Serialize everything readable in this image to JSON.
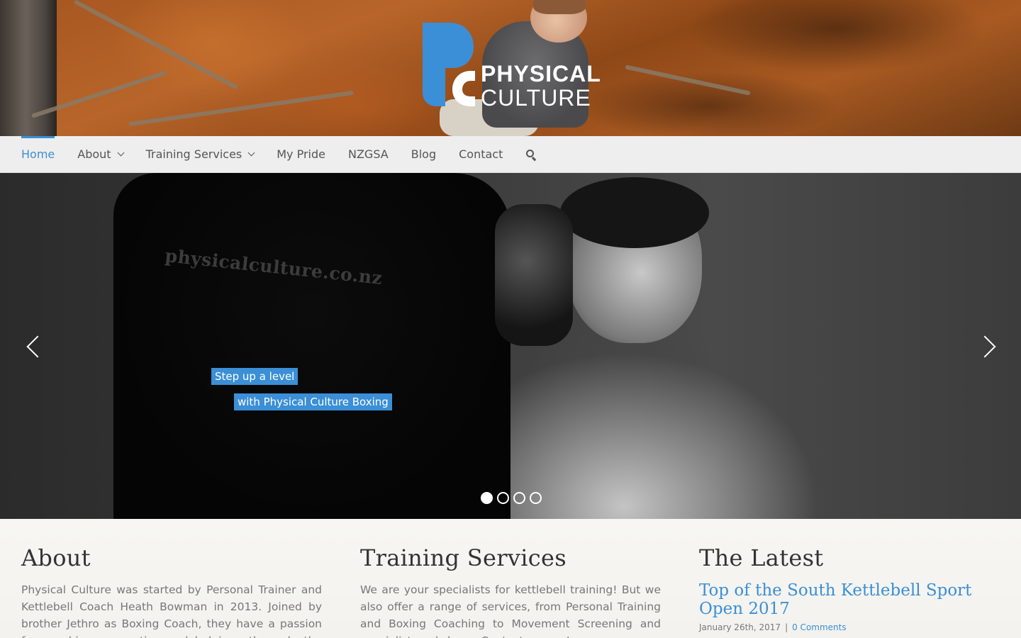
{
  "brand": {
    "logo_line1": "PHYSICAL",
    "logo_line2": "CULTURE",
    "logo_color": "#3b8fd6"
  },
  "nav": {
    "items": [
      {
        "label": "Home",
        "active": true
      },
      {
        "label": "About",
        "has_dropdown": true
      },
      {
        "label": "Training Services",
        "has_dropdown": true
      },
      {
        "label": "My Pride"
      },
      {
        "label": "NZGSA"
      },
      {
        "label": "Blog"
      },
      {
        "label": "Contact"
      }
    ],
    "search_icon": "search-icon"
  },
  "slider": {
    "shirt_text": "physicalculture.co.nz",
    "caption_line1": "Step up a level",
    "caption_line2": "with Physical Culture Boxing",
    "slide_count": 4,
    "active_slide": 1
  },
  "about": {
    "heading": "About",
    "text": "Physical Culture was started by Personal Trainer and Kettlebell Coach Heath Bowman in 2013. Joined by brother Jethro as Boxing Coach, they have a passion for coaching, competing and helping others do the same."
  },
  "services": {
    "heading": "Training Services",
    "text": "We are your specialists for kettlebell training! But we also offer a range of services, from Personal Training and Boxing Coaching to Movement Screening and specialist workshops. Contact us now!"
  },
  "latest": {
    "heading": "The Latest",
    "post_title": "Top of the South Kettlebell Sport Open 2017",
    "post_date": "January 26th, 2017",
    "separator": "|",
    "comments": "0 Comments"
  },
  "colors": {
    "accent": "#3b8fd6",
    "nav_bg": "#eeeeee",
    "body_text": "#777777"
  }
}
